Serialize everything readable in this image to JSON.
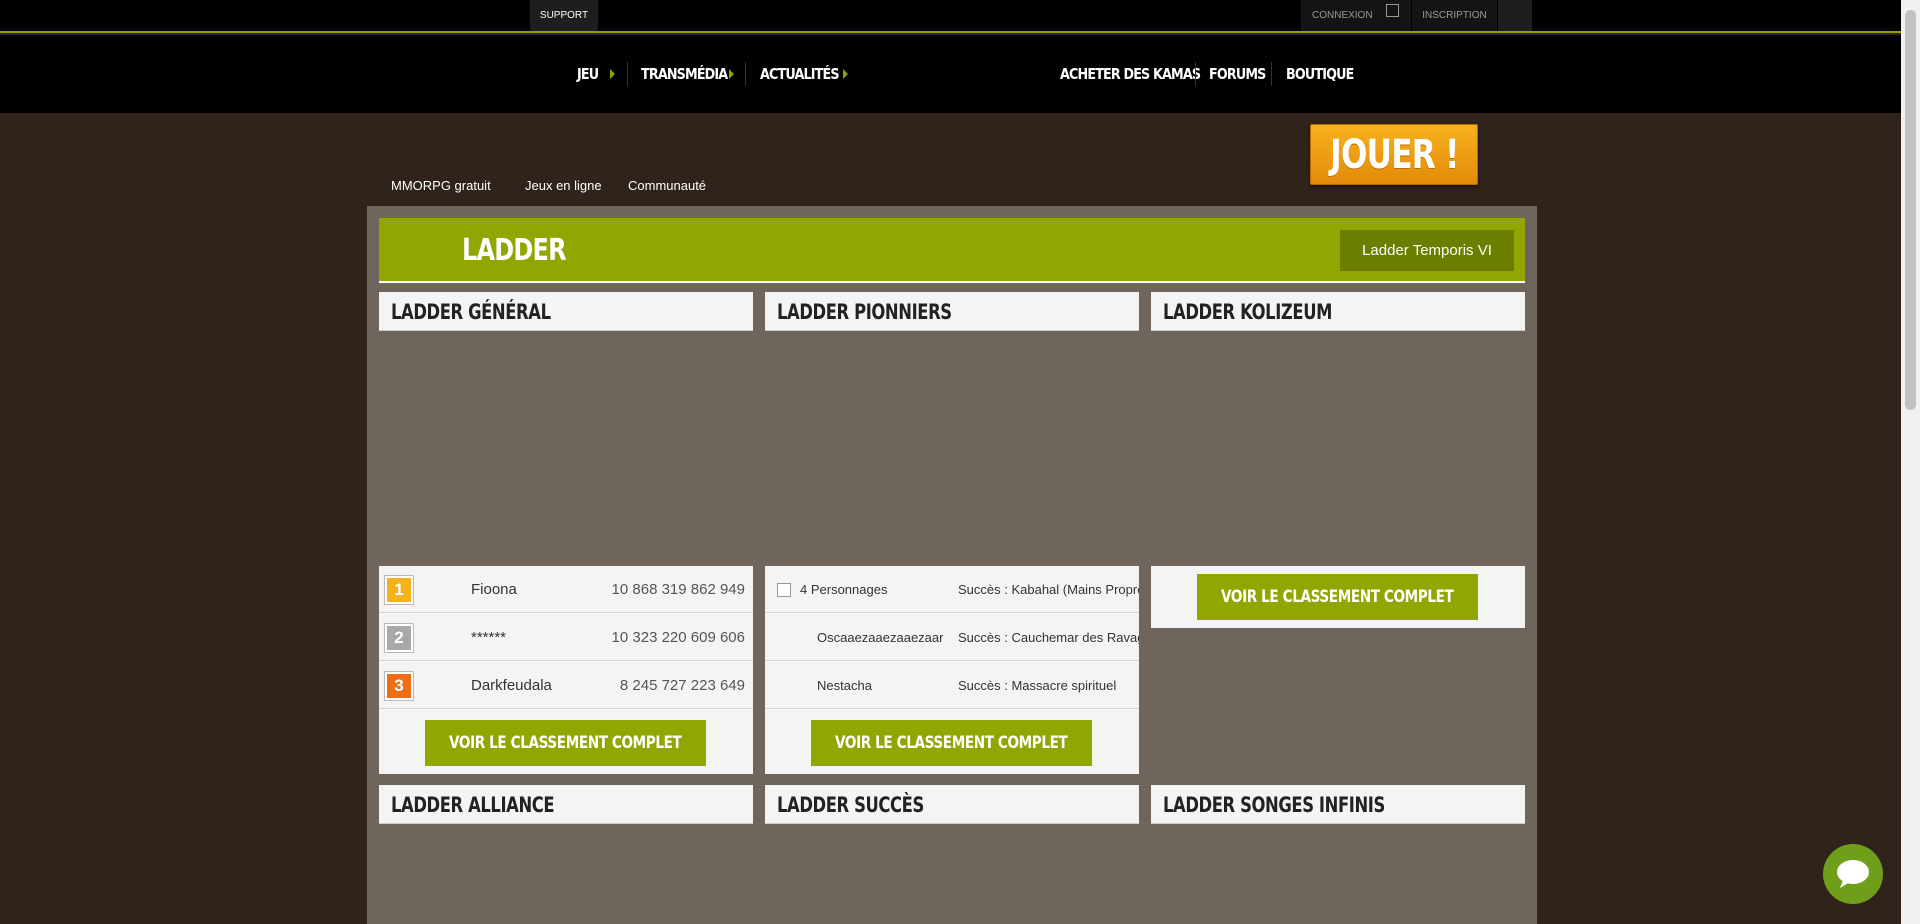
{
  "topbar": {
    "support": "SUPPORT",
    "connexion": "CONNEXION",
    "inscription": "INSCRIPTION"
  },
  "nav": {
    "items": [
      "JEU",
      "TRANSMÉDIA",
      "ACTUALITÉS"
    ],
    "right_items": [
      "ACHETER DES KAMAS",
      "FORUMS",
      "BOUTIQUE"
    ]
  },
  "subnav": [
    "MMORPG gratuit",
    "Jeux en ligne",
    "Communauté"
  ],
  "play_button": "JOUER !",
  "banner": {
    "title": "LADDER",
    "temporis": "Ladder Temporis VI"
  },
  "cards": {
    "general": "LADDER GÉNÉRAL",
    "pionniers": "LADDER PIONNIERS",
    "kolizeum": "LADDER KOLIZEUM",
    "alliance": "LADDER ALLIANCE",
    "succes": "LADDER SUCCÈS",
    "songes": "LADDER SONGES INFINIS"
  },
  "general_rows": [
    {
      "rank": "1",
      "name": "Fioona",
      "value": "10 868 319 862 949"
    },
    {
      "rank": "2",
      "name": "******",
      "value": "10 323 220 609 606"
    },
    {
      "rank": "3",
      "name": "Darkfeudala",
      "value": "8 245 727 223 649"
    }
  ],
  "pionniers_rows": [
    {
      "name": "4 Personnages",
      "succes": "Succès : Kabahal (Mains Propre"
    },
    {
      "name": "Oscaaezaaezaaezaar",
      "succes": "Succès : Cauchemar des Ravag"
    },
    {
      "name": "Nestacha",
      "succes": "Succès : Massacre spirituel"
    }
  ],
  "voir_label": "VOIR LE CLASSEMENT COMPLET",
  "colors": {
    "accent": "#91a600",
    "background": "#2f231b",
    "panel": "#6e665d",
    "play": "#f3a71a"
  }
}
